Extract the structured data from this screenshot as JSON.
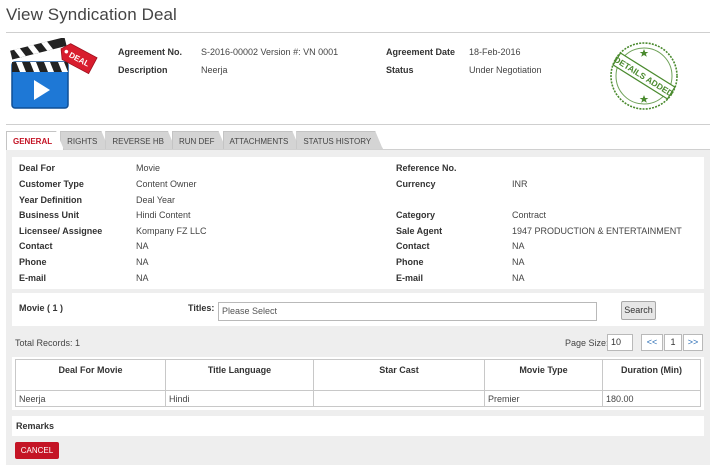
{
  "page": {
    "title": "View Syndication Deal"
  },
  "header": {
    "icon_badge": "DEAL",
    "agreement_no_label": "Agreement No.",
    "agreement_no_value": "S-2016-00002 Version #: VN 0001",
    "description_label": "Description",
    "description_value": "Neerja",
    "agreement_date_label": "Agreement Date",
    "agreement_date_value": "18-Feb-2016",
    "status_label": "Status",
    "status_value": "Under Negotiation",
    "stamp_text": "DETAILS ADDED",
    "stamp_color": "#4a8a2e"
  },
  "tabs": [
    {
      "label": "GENERAL",
      "active": true
    },
    {
      "label": "RIGHTS"
    },
    {
      "label": "REVERSE HB"
    },
    {
      "label": "RUN DEF"
    },
    {
      "label": "ATTACHMENTS"
    },
    {
      "label": "STATUS HISTORY"
    }
  ],
  "general": {
    "deal_for_label": "Deal For",
    "deal_for_value": "Movie",
    "customer_type_label": "Customer Type",
    "customer_type_value": "Content Owner",
    "year_definition_label": "Year Definition",
    "year_definition_value": "Deal Year",
    "business_unit_label": "Business Unit",
    "business_unit_value": "Hindi Content",
    "licensee_label": "Licensee/ Assignee",
    "licensee_value": "Kompany FZ LLC",
    "contact_label": "Contact",
    "contact_value": "NA",
    "phone_label": "Phone",
    "phone_value": "NA",
    "email_label": "E-mail",
    "email_value": "NA",
    "reference_no_label": "Reference No.",
    "reference_no_value": "",
    "currency_label": "Currency",
    "currency_value": "INR",
    "category_label": "Category",
    "category_value": "Contract",
    "sale_agent_label": "Sale Agent",
    "sale_agent_value": "1947 PRODUCTION & ENTERTAINMENT",
    "contact2_label": "Contact",
    "contact2_value": "NA",
    "phone2_label": "Phone",
    "phone2_value": "NA",
    "email2_label": "E-mail",
    "email2_value": "NA"
  },
  "search": {
    "movie_label": "Movie ( 1 )",
    "titles_label": "Titles:",
    "titles_placeholder": "Please Select",
    "search_button": "Search"
  },
  "pager": {
    "total_records": "Total Records:  1",
    "page_size_label": "Page Size:",
    "page_size_value": "10",
    "prev": "<<",
    "current_page": "1",
    "next": ">>"
  },
  "grid": {
    "headers": [
      "Deal For Movie",
      "Title Language",
      "Star Cast",
      "Movie Type",
      "Duration (Min)"
    ],
    "rows": [
      [
        "Neerja",
        "Hindi",
        "",
        "Premier",
        "180.00"
      ]
    ]
  },
  "remarks": {
    "label": "Remarks"
  },
  "actions": {
    "cancel": "CANCEL"
  },
  "colors": {
    "accent": "#c41425",
    "panel_bg": "#eeeeee",
    "link": "#2a6db5"
  }
}
